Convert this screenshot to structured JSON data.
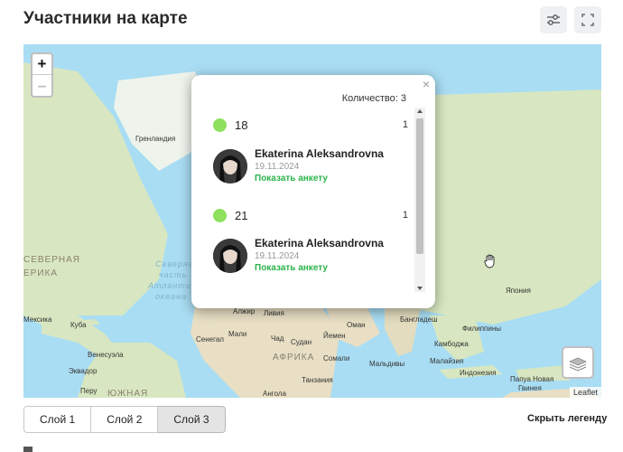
{
  "header": {
    "title": "Участники на карте",
    "filter_icon": "sliders-icon",
    "fullscreen_icon": "fullscreen-icon"
  },
  "map": {
    "zoom_in": "+",
    "zoom_out": "–",
    "attribution": "Leaflet",
    "labels": {
      "greenland": "Гренландия",
      "north_america": "СЕВЕРНАЯ",
      "north_america2": "ЕРИКА",
      "mexico": "Мексика",
      "cuba": "Куба",
      "venezuela": "Венесуэла",
      "ecuador": "Эквадор",
      "peru": "Перу",
      "south": "ЮЖНАЯ",
      "algeria": "Алжир",
      "libya": "Ливия",
      "mali": "Мали",
      "senegal": "Сенегал",
      "chad": "Чад",
      "sudan": "Судан",
      "africa": "АФРИКА",
      "angola": "Ангола",
      "tanzania": "Танзания",
      "somalia": "Сомали",
      "yemen": "Йемен",
      "oman": "Оман",
      "maldives": "Мальдивы",
      "bangladesh": "Бангладеш",
      "cambodia": "Камбоджа",
      "philippines": "Филиппины",
      "malaysia": "Малайзия",
      "indonesia": "Индонезия",
      "png": "Папуа Новая",
      "png2": "Гвинея",
      "japan": "Япония",
      "sea1": "Северная",
      "sea2": "часть",
      "sea3": "Атлантического",
      "sea4": "океана"
    }
  },
  "popup": {
    "close": "×",
    "count_label": "Количество: 3",
    "groups": [
      {
        "value": "18",
        "count": "1",
        "dot_color": "#8ee05e",
        "person": {
          "name": "Ekaterina Aleksandrovna",
          "date": "19.11.2024",
          "link": "Показать анкету"
        }
      },
      {
        "value": "21",
        "count": "1",
        "dot_color": "#8ee05e",
        "person": {
          "name": "Ekaterina Aleksandrovna",
          "date": "19.11.2024",
          "link": "Показать анкету"
        }
      }
    ]
  },
  "layers_tabs": [
    "Слой 1",
    "Слой 2",
    "Слой 3"
  ],
  "active_tab": "Слой 3",
  "hide_legend": "Скрыть легенду",
  "colors": {
    "accent_green": "#2bb34a",
    "dot_green": "#8ee05e",
    "ocean": "#a9ddf3",
    "land": "#d8e7c1"
  }
}
